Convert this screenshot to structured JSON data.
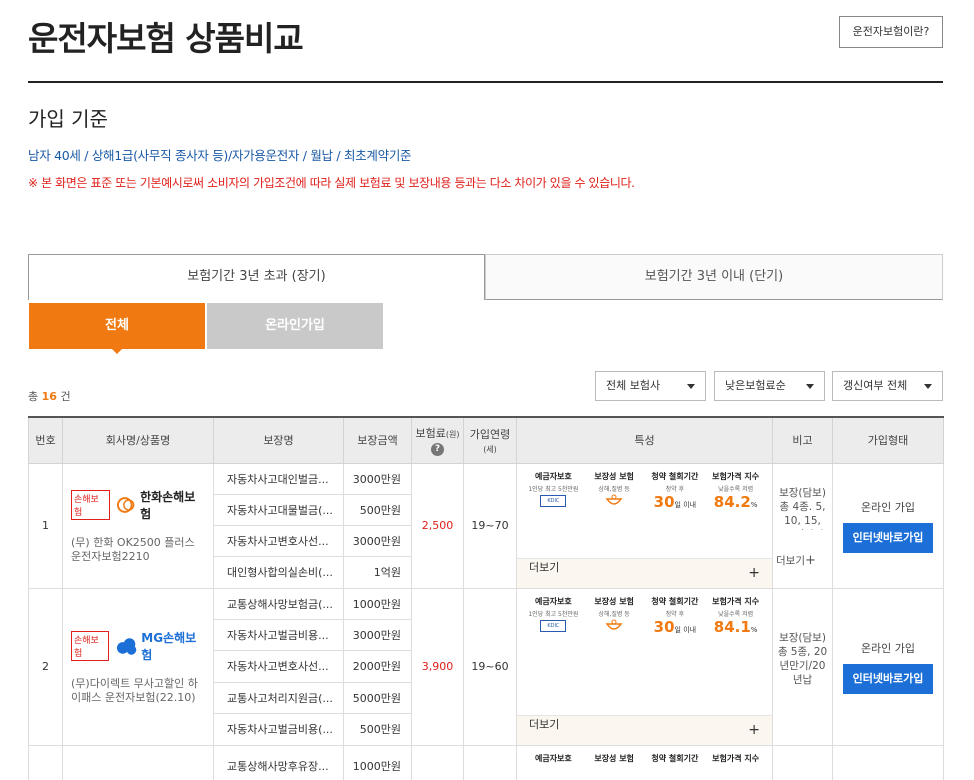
{
  "header": {
    "title": "운전자보험 상품비교",
    "what_button": "운전자보험이란?"
  },
  "criteria": {
    "title": "가입 기준",
    "conditions": "남자 40세 / 상해1급(사무직 종사자 등)/자가용운전자 / 월납 / 최초계약기준",
    "warning": "※ 본 화면은 표준 또는 기본예시로써 소비자의 가입조건에 따라 실제 보험료 및 보장내용 등과는 다소 차이가 있을 수 있습니다."
  },
  "tabs": [
    "보험기간 3년 초과 (장기)",
    "보험기간 3년 이내 (단기)"
  ],
  "subtabs": [
    "전체",
    "온라인가입"
  ],
  "count": {
    "prefix": "총",
    "value": "16",
    "suffix": "건"
  },
  "filters": {
    "company": "전체 보험사",
    "sort": "낮은보험료순",
    "renew": "갱신여부 전체"
  },
  "table": {
    "headers": {
      "no": "번호",
      "company": "회사명/상품명",
      "coverage": "보장명",
      "amount": "보장금액",
      "premium": "보험료",
      "premium_unit": "(원)",
      "period": "가입연령",
      "period_unit": "(세)",
      "features": "특성",
      "note": "비고",
      "join": "가입형태"
    },
    "feature_labels": {
      "f1": "예금자보호",
      "f1_sub": "1인당 최고 5천만원",
      "f2": "보장성 보험",
      "f2_sub": "상해,질병 등",
      "f3": "청약 철회기간",
      "f3_sub": "청약 후",
      "f4": "보험가격 지수",
      "f4_sub": "낮을수록 저렴",
      "days_unit": "일 이내",
      "pct": "%"
    },
    "more": "더보기",
    "rows": [
      {
        "no": "1",
        "tag": "손해보험",
        "brand": "한화손해보험",
        "product": "(무) 한화 OK2500 플러스 운전자보험2210",
        "coverages": [
          [
            "자동차사고대인벌금...",
            "3000만원"
          ],
          [
            "자동차사고대물벌금(...",
            "500만원"
          ],
          [
            "자동차사고변호사선...",
            "3000만원"
          ],
          [
            "대인형사합의실손비(...",
            "1억원"
          ]
        ],
        "premium": "2,500",
        "age": "19~70",
        "days": "30",
        "index": "84.2",
        "note": "보장(담보) 총 4종. 5, 10, 15, 20년만기 ....",
        "join": "온라인 가입",
        "button": "인터넷바로가입"
      },
      {
        "no": "2",
        "tag": "손해보험",
        "brand": "MG손해보험",
        "brand_small": "오늘부터!",
        "product": "(무)다이렉트 무사고할인 하이패스 운전자보험(22.10)",
        "coverages": [
          [
            "교통상해사망보험금(...",
            "1000만원"
          ],
          [
            "자동차사고벌금비용...",
            "3000만원"
          ],
          [
            "자동차사고변호사선...",
            "2000만원"
          ],
          [
            "교통사고처리지원금(...",
            "5000만원"
          ],
          [
            "자동차사고벌금비용(...",
            "500만원"
          ]
        ],
        "premium": "3,900",
        "age": "19~60",
        "days": "30",
        "index": "84.1",
        "note": "보장(담보) 총 5종, 20년만기/20년납",
        "join": "온라인 가입",
        "button": "인터넷바로가입"
      },
      {
        "coverages": [
          [
            "교통상해사망후유장...",
            "1000만원"
          ]
        ]
      }
    ]
  },
  "colors": {
    "accent": "#f07a11",
    "blue": "#1b6fd6",
    "red": "#e0201b"
  }
}
